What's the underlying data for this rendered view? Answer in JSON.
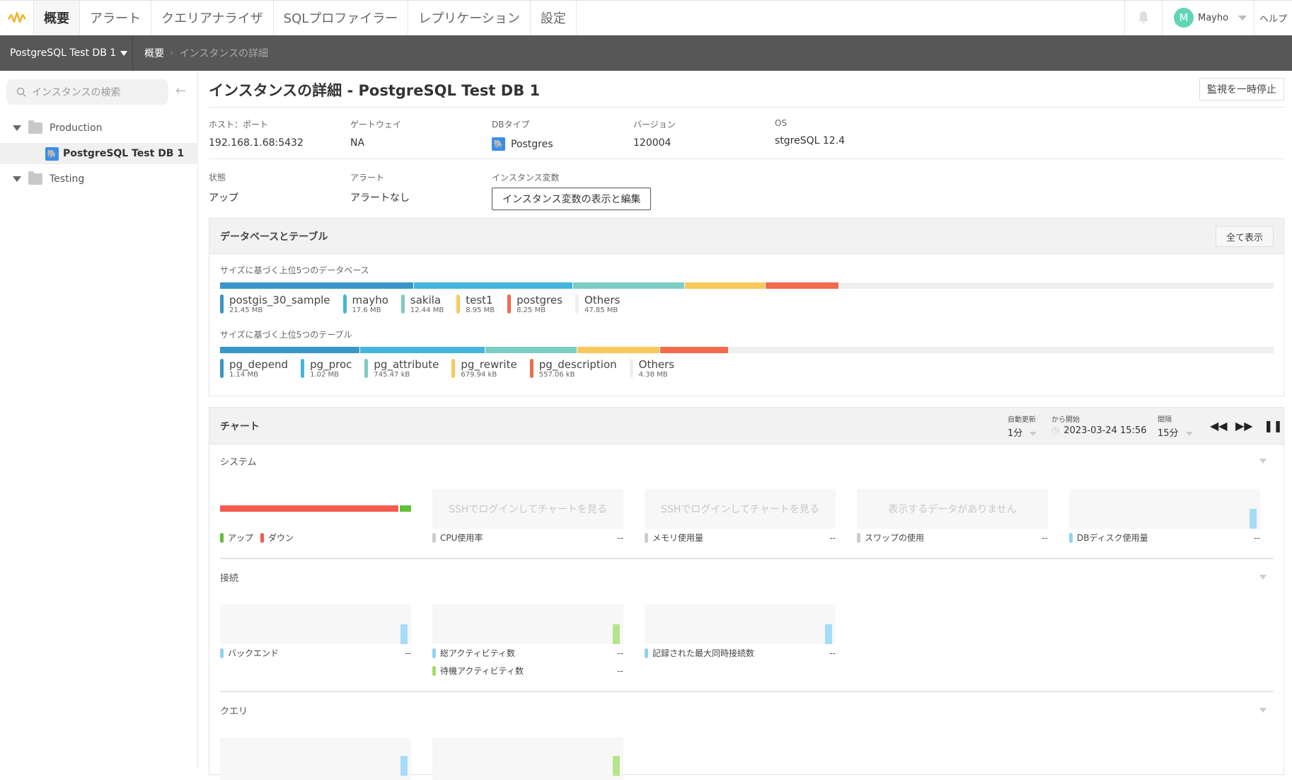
{
  "topnav": {
    "tabs": [
      {
        "label": "概要",
        "active": true
      },
      {
        "label": "アラート"
      },
      {
        "label": "クエリアナライザ"
      },
      {
        "label": "SQLプロファイラー"
      },
      {
        "label": "レプリケーション"
      },
      {
        "label": "設定"
      }
    ],
    "user": {
      "initial": "M",
      "name": "Mayho"
    },
    "help_label": "ヘルプ"
  },
  "breadcrumb": {
    "instance_selector": "PostgreSQL Test DB 1",
    "items": [
      "概要",
      "インスタンスの詳細"
    ]
  },
  "sidebar": {
    "search_placeholder": "インスタンスの検索",
    "groups": [
      {
        "name": "Production",
        "instances": [
          "PostgreSQL Test DB 1"
        ]
      },
      {
        "name": "Testing",
        "instances": []
      }
    ]
  },
  "page": {
    "title": "インスタンスの詳細 - PostgreSQL Test DB 1",
    "pause_button": "監視を一時停止",
    "fields": {
      "host_label": "ホスト：ポート",
      "host_value": "192.168.1.68:5432",
      "gateway_label": "ゲートウェイ",
      "gateway_value": "NA",
      "dbtype_label": "DBタイプ",
      "dbtype_value": "Postgres",
      "version_label": "バージョン",
      "version_value": "120004",
      "os_label": "OS",
      "os_value": "stgreSQL 12.4",
      "status_label": "状態",
      "status_value": "アップ",
      "alert_label": "アラート",
      "alert_value": "アラートなし",
      "vars_label": "インスタンス変数",
      "vars_button": "インスタンス変数の表示と編集"
    }
  },
  "db_tables": {
    "title": "データベースとテーブル",
    "show_all": "全て表示",
    "databases_label": "サイズに基づく上位5つのデータベース",
    "databases": [
      {
        "name": "postgis_30_sample",
        "size": "21.45 MB",
        "share": 18.4,
        "color": "#3a96c8"
      },
      {
        "name": "mayho",
        "size": "17.6 MB",
        "share": 15.1,
        "color": "#44b5dc"
      },
      {
        "name": "sakila",
        "size": "12.44 MB",
        "share": 10.6,
        "color": "#7ccdc4"
      },
      {
        "name": "test1",
        "size": "8.95 MB",
        "share": 7.7,
        "color": "#f8c95a"
      },
      {
        "name": "postgres",
        "size": "8.25 MB",
        "share": 7.0,
        "color": "#f26b4d"
      },
      {
        "name": "Others",
        "size": "47.85 MB",
        "share": 41.2,
        "color": "#efefef"
      }
    ],
    "tables_label": "サイズに基づく上位5つのテーブル",
    "tables": [
      {
        "name": "pg_depend",
        "size": "1.14 MB",
        "share": 13.3,
        "color": "#3a96c8"
      },
      {
        "name": "pg_proc",
        "size": "1.02 MB",
        "share": 11.9,
        "color": "#44b5dc"
      },
      {
        "name": "pg_attribute",
        "size": "745.47 kB",
        "share": 8.7,
        "color": "#7ccdc4"
      },
      {
        "name": "pg_rewrite",
        "size": "679.94 kB",
        "share": 7.9,
        "color": "#f8c95a"
      },
      {
        "name": "pg_description",
        "size": "557.06 kB",
        "share": 6.5,
        "color": "#f26b4d"
      },
      {
        "name": "Others",
        "size": "4.38 MB",
        "share": 51.7,
        "color": "#efefef"
      }
    ]
  },
  "charts": {
    "title": "チャート",
    "auto_refresh_label": "自動更新",
    "auto_refresh_value": "1分",
    "start_label": "から開始",
    "start_value": "2023-03-24 15:56",
    "interval_label": "間隔",
    "interval_value": "15分",
    "system": {
      "title": "システム",
      "updown": {
        "up_label": "アップ",
        "down_label": "ダウン",
        "down_share": 0.94,
        "up_share": 0.06
      },
      "cards": [
        {
          "label": "CPU使用率",
          "message": "SSHでログインしてチャートを見る",
          "value": "--"
        },
        {
          "label": "メモリ使用量",
          "message": "SSHでログインしてチャートを見る",
          "value": "--"
        },
        {
          "label": "スワップの使用",
          "message": "表示するデータがありません",
          "value": "--"
        },
        {
          "label": "DBディスク使用量",
          "message": "",
          "value": "--"
        }
      ]
    },
    "connections": {
      "title": "接続",
      "cards": [
        {
          "label": "バックエンド",
          "value": "--"
        },
        {
          "label": "総アクティビティ数",
          "value": "--",
          "label2": "待機アクティビティ数",
          "value2": "--"
        },
        {
          "label": "記録された最大同時接続数",
          "value": "--"
        }
      ]
    },
    "queries": {
      "title": "クエリ"
    }
  }
}
